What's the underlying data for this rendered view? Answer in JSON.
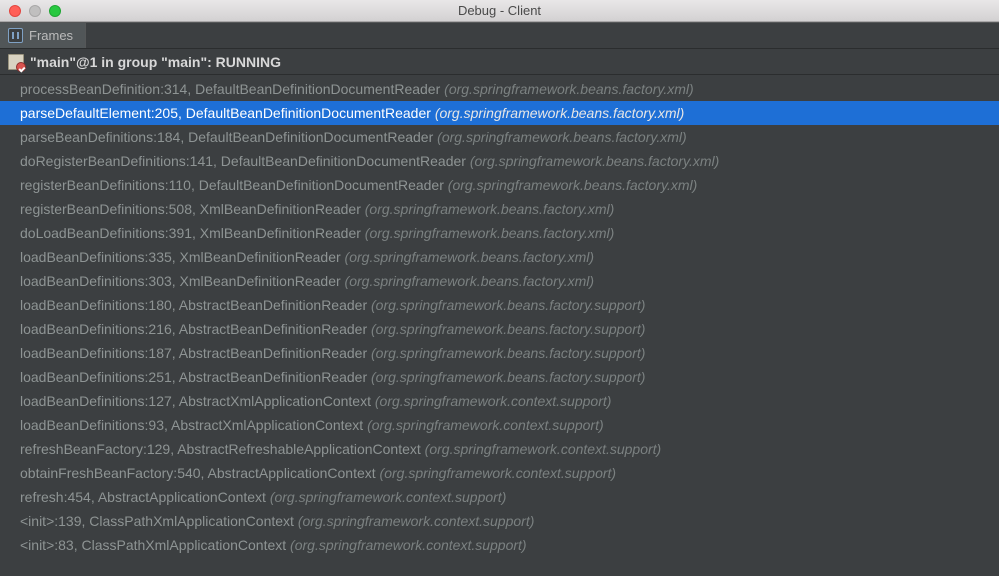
{
  "window": {
    "title": "Debug - Client"
  },
  "tab": {
    "label": "Frames"
  },
  "thread": {
    "label": "\"main\"@1 in group \"main\": RUNNING"
  },
  "frames": [
    {
      "method": "processBeanDefinition:314, DefaultBeanDefinitionDocumentReader",
      "pkg": "(org.springframework.beans.factory.xml)",
      "selected": false
    },
    {
      "method": "parseDefaultElement:205, DefaultBeanDefinitionDocumentReader",
      "pkg": "(org.springframework.beans.factory.xml)",
      "selected": true
    },
    {
      "method": "parseBeanDefinitions:184, DefaultBeanDefinitionDocumentReader",
      "pkg": "(org.springframework.beans.factory.xml)",
      "selected": false
    },
    {
      "method": "doRegisterBeanDefinitions:141, DefaultBeanDefinitionDocumentReader",
      "pkg": "(org.springframework.beans.factory.xml)",
      "selected": false
    },
    {
      "method": "registerBeanDefinitions:110, DefaultBeanDefinitionDocumentReader",
      "pkg": "(org.springframework.beans.factory.xml)",
      "selected": false
    },
    {
      "method": "registerBeanDefinitions:508, XmlBeanDefinitionReader",
      "pkg": "(org.springframework.beans.factory.xml)",
      "selected": false
    },
    {
      "method": "doLoadBeanDefinitions:391, XmlBeanDefinitionReader",
      "pkg": "(org.springframework.beans.factory.xml)",
      "selected": false
    },
    {
      "method": "loadBeanDefinitions:335, XmlBeanDefinitionReader",
      "pkg": "(org.springframework.beans.factory.xml)",
      "selected": false
    },
    {
      "method": "loadBeanDefinitions:303, XmlBeanDefinitionReader",
      "pkg": "(org.springframework.beans.factory.xml)",
      "selected": false
    },
    {
      "method": "loadBeanDefinitions:180, AbstractBeanDefinitionReader",
      "pkg": "(org.springframework.beans.factory.support)",
      "selected": false
    },
    {
      "method": "loadBeanDefinitions:216, AbstractBeanDefinitionReader",
      "pkg": "(org.springframework.beans.factory.support)",
      "selected": false
    },
    {
      "method": "loadBeanDefinitions:187, AbstractBeanDefinitionReader",
      "pkg": "(org.springframework.beans.factory.support)",
      "selected": false
    },
    {
      "method": "loadBeanDefinitions:251, AbstractBeanDefinitionReader",
      "pkg": "(org.springframework.beans.factory.support)",
      "selected": false
    },
    {
      "method": "loadBeanDefinitions:127, AbstractXmlApplicationContext",
      "pkg": "(org.springframework.context.support)",
      "selected": false
    },
    {
      "method": "loadBeanDefinitions:93, AbstractXmlApplicationContext",
      "pkg": "(org.springframework.context.support)",
      "selected": false
    },
    {
      "method": "refreshBeanFactory:129, AbstractRefreshableApplicationContext",
      "pkg": "(org.springframework.context.support)",
      "selected": false
    },
    {
      "method": "obtainFreshBeanFactory:540, AbstractApplicationContext",
      "pkg": "(org.springframework.context.support)",
      "selected": false
    },
    {
      "method": "refresh:454, AbstractApplicationContext",
      "pkg": "(org.springframework.context.support)",
      "selected": false
    },
    {
      "method": "<init>:139, ClassPathXmlApplicationContext",
      "pkg": "(org.springframework.context.support)",
      "selected": false
    },
    {
      "method": "<init>:83, ClassPathXmlApplicationContext",
      "pkg": "(org.springframework.context.support)",
      "selected": false
    }
  ]
}
